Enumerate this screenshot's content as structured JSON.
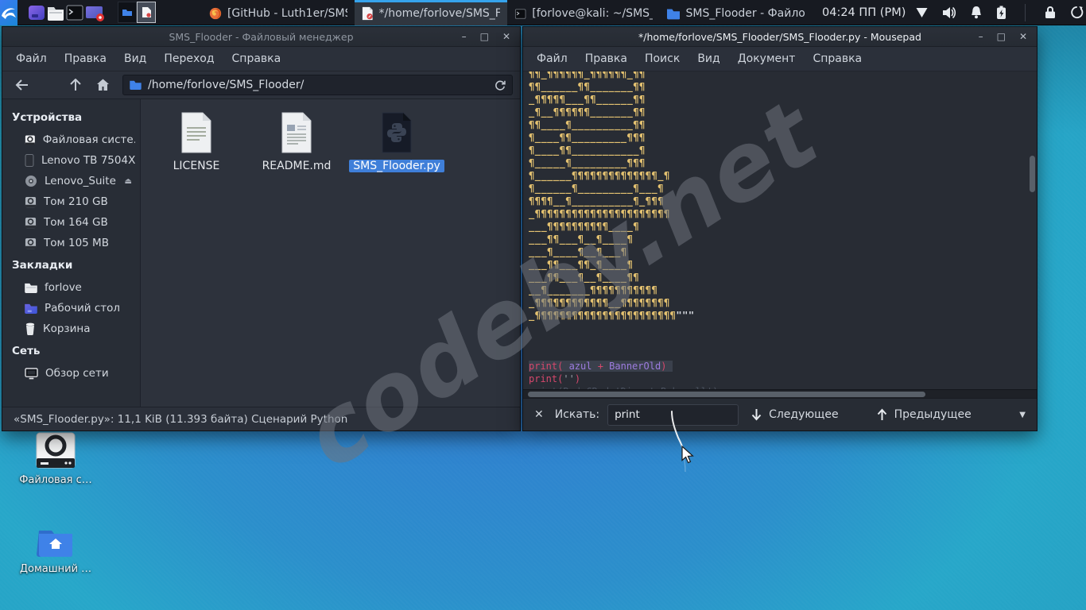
{
  "panel": {
    "taskbar": [
      {
        "label": "[GitHub - Luth1er/SMS…"
      },
      {
        "label": "*/home/forlove/SMS_F…"
      },
      {
        "label": "[forlove@kali: ~/SMS_…"
      },
      {
        "label": "SMS_Flooder - Файло…"
      }
    ],
    "clock": "04:24 ПП (PM)"
  },
  "file_manager": {
    "title": "SMS_Flooder - Файловый менеджер",
    "menu": [
      "Файл",
      "Правка",
      "Вид",
      "Переход",
      "Справка"
    ],
    "path": "/home/forlove/SMS_Flooder/",
    "window_buttons": {
      "minimize": "–",
      "maximize": "□",
      "close": "✕"
    },
    "sidebar": {
      "devices_header": "Устройства",
      "devices": [
        "Файловая систе…",
        "Lenovo TB 7504X",
        "Lenovo_Suite",
        "Том 210 GB",
        "Том 164 GB",
        "Том 105 MB"
      ],
      "eject_symbol": "⏏",
      "bookmarks_header": "Закладки",
      "bookmarks": [
        "forlove",
        "Рабочий стол",
        "Корзина"
      ],
      "network_header": "Сеть",
      "network": [
        "Обзор сети"
      ]
    },
    "files": [
      "LICENSE",
      "README.md",
      "SMS_Flooder.py"
    ],
    "statusbar": "«SMS_Flooder.py»: 11,1 KiB (11.393 байта) Сценарий Python"
  },
  "editor": {
    "title": "*/home/forlove/SMS_Flooder/SMS_Flooder.py - Mousepad",
    "menu": [
      "Файл",
      "Правка",
      "Поиск",
      "Вид",
      "Документ",
      "Справка"
    ],
    "window_buttons": {
      "minimize": "–",
      "maximize": "□",
      "close": "✕"
    },
    "ascii_art": [
      "¶¶_¶¶¶¶¶¶_¶¶¶¶¶¶_¶¶",
      "¶¶______¶¶_______¶¶",
      "_¶¶¶¶¶___¶¶______¶¶",
      "_¶__¶¶¶¶¶¶_______¶¶",
      "¶¶____¶__________¶¶",
      "¶____¶¶_________¶¶¶",
      "¶____¶¶___________¶",
      "¶_____¶_________¶¶¶",
      "¶______¶¶¶¶¶¶¶¶¶¶¶¶¶¶_¶",
      "¶______¶_________¶___¶",
      "¶¶¶¶__¶__________¶_¶¶¶",
      "_¶¶¶¶¶¶¶¶¶¶¶¶¶¶¶¶¶¶¶¶¶¶",
      "___¶¶¶¶¶¶¶¶¶¶____¶",
      "___¶¶___¶__¶____¶",
      "___¶____¶__¶___¶",
      "___¶¶___¶¶_¶____¶",
      "___¶¶___¶__¶____¶¶",
      "__¶_______¶¶¶¶¶¶¶¶¶¶¶",
      "_¶¶¶¶¶¶¶¶¶¶¶¶__¶¶¶¶¶¶¶¶",
      "_¶¶¶¶¶¶¶¶¶¶¶¶¶¶¶¶¶¶¶¶¶¶¶"
    ],
    "art_quotes": "\"\"\"",
    "code": {
      "l1_kw1": "print",
      "l1_p1": "( ",
      "l1_v1": "azul ",
      "l1_op": "+",
      "l1_v2": " BannerOld",
      "l1_p2": ")",
      "l2_kw": "print",
      "l2_p1": "(",
      "l2_s": "''",
      "l2_p2": ")",
      "l3_clipped": "print(Red+CRed+'Direct Robocall')"
    },
    "search": {
      "label": "Искать:",
      "query": "print",
      "next": "Следующее",
      "prev": "Предыдущее"
    }
  },
  "desktop": {
    "icons": [
      "Файловая с…",
      "Домашний …"
    ]
  },
  "watermark": "codeby.net",
  "colors": {
    "accent_blue": "#3f7fd9",
    "active_task_indicator": "#36a3ec",
    "art_yellow": "#e3c170",
    "desktop_teal": "#27a7c9",
    "desktop_blue": "#3279d2"
  }
}
